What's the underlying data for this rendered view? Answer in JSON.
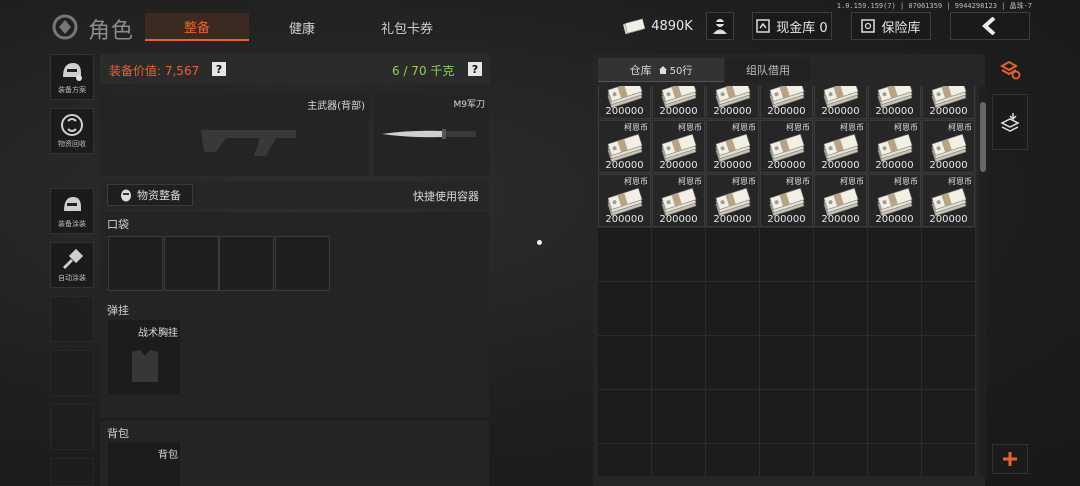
{
  "version": "1.0.159.159(7) | 07061359 | 9944298123 | 晶珠-7",
  "header": {
    "title": "角色",
    "tabs": [
      {
        "label": "整备",
        "active": true
      },
      {
        "label": "健康",
        "active": false
      },
      {
        "label": "礼包卡券",
        "active": false
      }
    ],
    "currency": "4890K",
    "cash_vault": "现金库 0",
    "safe_box": "保险库"
  },
  "rail": [
    "装备方案",
    "物资回收",
    "装备涂装",
    "自动涂装"
  ],
  "loadout": {
    "value_label": "装备价值: 7,567",
    "weight": "6 / 70 千克",
    "help": "?",
    "primary_weapon": "主武器(背部)",
    "melee": "M9军刀",
    "supply_button": "物资整备",
    "quick_container": "快捷使用容器",
    "pocket_label": "口袋",
    "chest_label": "弹挂",
    "chest_slot": "战术胸挂",
    "backpack_label": "背包",
    "backpack_slot": "背包"
  },
  "warehouse": {
    "tabs": [
      {
        "label": "仓库",
        "badge": "50行",
        "active": true
      },
      {
        "label": "组队借用",
        "active": false
      }
    ],
    "item_name": "柯恩币",
    "item_count": "200000",
    "rows": [
      {
        "items": 7,
        "partial": true
      },
      {
        "items": 7,
        "partial": false
      },
      {
        "items": 7,
        "partial": false
      }
    ]
  },
  "colors": {
    "accent": "#e8632c",
    "weight_green": "#8fd14f"
  },
  "icons": [
    "helmet-icon",
    "recycle-icon",
    "paint-icon",
    "auto-paint-icon",
    "money-icon",
    "avatar-icon",
    "back-chevron-icon",
    "sort-icon",
    "deposit-icon",
    "plus-icon"
  ]
}
